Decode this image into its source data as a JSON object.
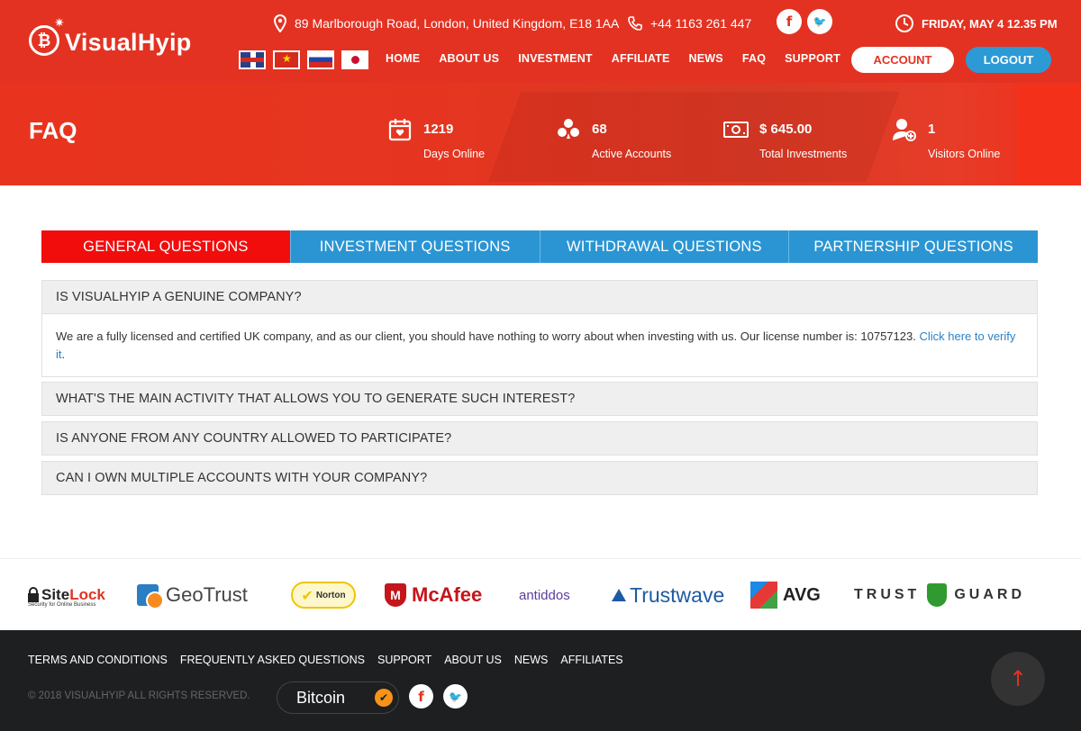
{
  "brand": {
    "name": "VisualHyip",
    "coin_glyph": "₿"
  },
  "contact": {
    "address": "89 Marlborough Road, London, United Kingdom, E18 1AA",
    "phone": "+44 1163 261 447",
    "datetime": "FRIDAY, MAY 4 12.35 PM"
  },
  "social": {
    "facebook": "f",
    "twitter": "🐦"
  },
  "languages": [
    "English",
    "Vietnamese",
    "Russian",
    "Japanese"
  ],
  "nav": [
    "HOME",
    "ABOUT US",
    "INVESTMENT",
    "AFFILIATE",
    "NEWS",
    "FAQ",
    "SUPPORT"
  ],
  "auth": {
    "account": "ACCOUNT",
    "logout": "LOGOUT"
  },
  "hero": {
    "title": "FAQ",
    "stats": [
      {
        "value": "1219",
        "label": "Days Online",
        "icon": "calendar-icon"
      },
      {
        "value": "68",
        "label": "Active Accounts",
        "icon": "users-icon"
      },
      {
        "value": "$ 645.00",
        "label": "Total Investments",
        "icon": "money-icon"
      },
      {
        "value": "1",
        "label": "Visitors Online",
        "icon": "visitor-icon"
      }
    ]
  },
  "tabs": [
    "GENERAL QUESTIONS",
    "INVESTMENT QUESTIONS",
    "WITHDRAWAL QUESTIONS",
    "PARTNERSHIP QUESTIONS"
  ],
  "active_tab": 0,
  "faq": [
    {
      "question": "IS VISUALHYIP A GENUINE COMPANY?",
      "answer": "We are a fully licensed and certified UK company, and as our client, you should have nothing to worry about when investing with us. Our license number is: 10757123.",
      "answer_link": "Click here to verify it",
      "open": true
    },
    {
      "question": "WHAT'S THE MAIN ACTIVITY THAT ALLOWS YOU TO GENERATE SUCH INTEREST?",
      "open": false
    },
    {
      "question": "IS ANYONE FROM ANY COUNTRY ALLOWED TO PARTICIPATE?",
      "open": false
    },
    {
      "question": "CAN I OWN MULTIPLE ACCOUNTS WITH YOUR COMPANY?",
      "open": false
    }
  ],
  "trust_logos": {
    "sitelock_a": "Site",
    "sitelock_b": "Lock",
    "sitelock_sub": "Security for Online Business",
    "geotrust": "GeoTrust",
    "norton": "Norton",
    "mcafee": "McAfee",
    "antiddos": "antiddos",
    "trustwave": "Trustwave",
    "avg": "AVG",
    "trustguard_a": "TRUST",
    "trustguard_b": "GUARD"
  },
  "footer": {
    "links": [
      "TERMS AND CONDITIONS",
      "FREQUENTLY ASKED QUESTIONS",
      "SUPPORT",
      "ABOUT US",
      "NEWS",
      "AFFILIATES"
    ],
    "copyright": "© 2018 VISUALHYIP ALL RIGHTS RESERVED.",
    "badge": "Bitcoin",
    "scroll_glyph": "↑"
  },
  "colors": {
    "brand_red": "#e33222",
    "tab_blue": "#2b95d3",
    "tab_active": "#f20d0d",
    "logout_blue": "#2c9ad5",
    "footer_bg": "#1d1f20"
  }
}
